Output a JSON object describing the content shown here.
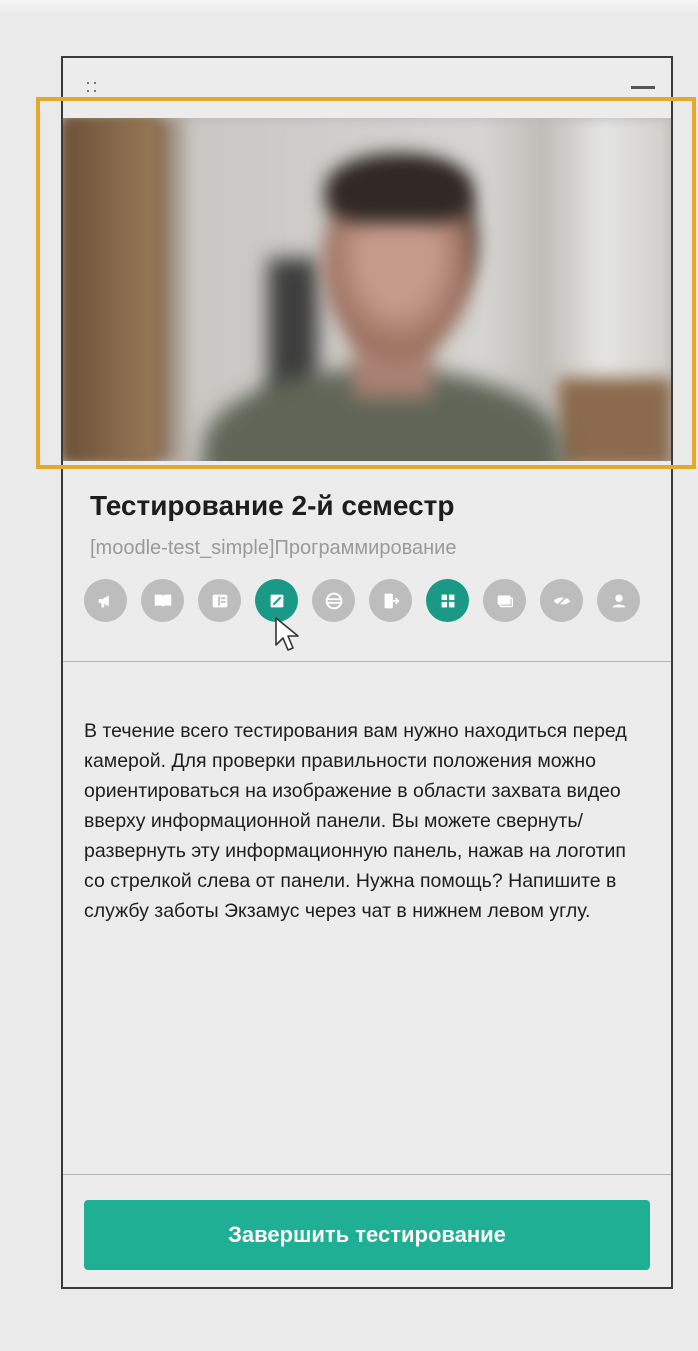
{
  "panel": {
    "title": "Тестирование 2-й семестр",
    "subtitle": "[moodle-test_simple]Программирование",
    "description": "В течение всего тестирования вам нужно находиться перед камерой. Для проверки правильности положения можно ориентироваться на изображение в области захвата видео вверху информационной панели. Вы можете свернуть/развернуть эту информационную панель, нажав на логотип со стрелкой слева от панели. Нужна помощь? Напишите в службу заботы Экзамус через чат в нижнем левом углу.",
    "finish_button": "Завершить тестирование"
  },
  "toolbar_icons": [
    {
      "name": "megaphone-icon",
      "active": false
    },
    {
      "name": "book-icon",
      "active": false
    },
    {
      "name": "calculator-icon",
      "active": false
    },
    {
      "name": "notepad-icon",
      "active": true
    },
    {
      "name": "browser-icon",
      "active": false
    },
    {
      "name": "exit-icon",
      "active": false
    },
    {
      "name": "grid-icon",
      "active": true
    },
    {
      "name": "screen-share-icon",
      "active": false
    },
    {
      "name": "eye-off-icon",
      "active": false
    },
    {
      "name": "user-icon",
      "active": false
    }
  ],
  "colors": {
    "accent": "#1faf94",
    "active_icon": "#1a9a86",
    "inactive_icon": "#bdbdbd",
    "highlight_border": "#e5a82a"
  }
}
